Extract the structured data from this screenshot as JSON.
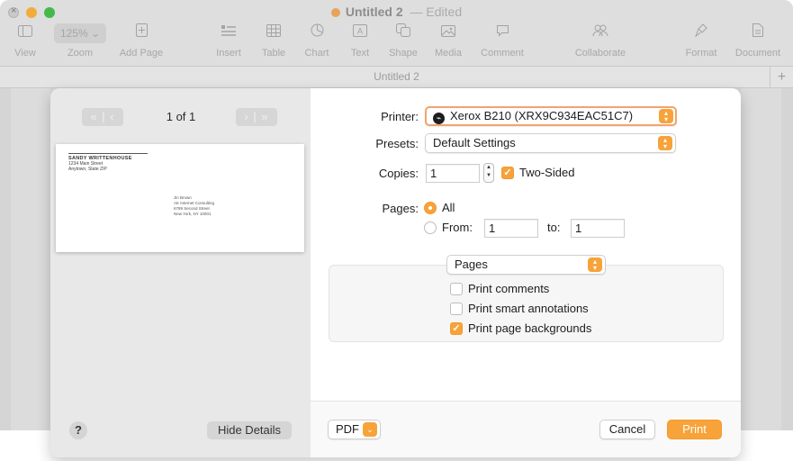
{
  "window": {
    "title": "Untitled 2",
    "edited": "Edited",
    "tab_title": "Untitled 2",
    "new_tab_symbol": "+"
  },
  "toolbar": {
    "view": "View",
    "zoom_value": "125%",
    "zoom": "Zoom",
    "add_page": "Add Page",
    "insert": "Insert",
    "table": "Table",
    "chart": "Chart",
    "text": "Text",
    "shape": "Shape",
    "media": "Media",
    "comment": "Comment",
    "collaborate": "Collaborate",
    "format": "Format",
    "document": "Document"
  },
  "preview": {
    "page_count": "1 of 1",
    "envelope": {
      "sender_name": "SANDY WRITTENHOUSE",
      "sender_line1": "1234 Main Street",
      "sender_line2": "Anytown, State ZIP",
      "recipient_name": "Jin Brown",
      "recipient_line1": "AK Internet Consulting",
      "recipient_line2": "6789 Second Street",
      "recipient_line3": "New York, NY 10001"
    },
    "help_label": "?",
    "hide_details_label": "Hide Details"
  },
  "print_settings": {
    "printer_label": "Printer:",
    "printer_value": "Xerox B210 (XRX9C934EAC51C7)",
    "presets_label": "Presets:",
    "presets_value": "Default Settings",
    "copies_label": "Copies:",
    "copies_value": "1",
    "two_sided_label": "Two-Sided",
    "two_sided_checked": true,
    "pages_label": "Pages:",
    "pages_all_label": "All",
    "pages_from_label": "From:",
    "pages_from_value": "1",
    "pages_to_label": "to:",
    "pages_to_value": "1",
    "section_value": "Pages",
    "print_comments_label": "Print comments",
    "print_comments_checked": false,
    "print_smart_annotations_label": "Print smart annotations",
    "print_smart_annotations_checked": false,
    "print_page_backgrounds_label": "Print page backgrounds",
    "print_page_backgrounds_checked": true
  },
  "footer": {
    "pdf_label": "PDF",
    "cancel_label": "Cancel",
    "print_label": "Print"
  },
  "colors": {
    "accent": "#f7a33a",
    "focus_ring": "#f2a36b"
  }
}
